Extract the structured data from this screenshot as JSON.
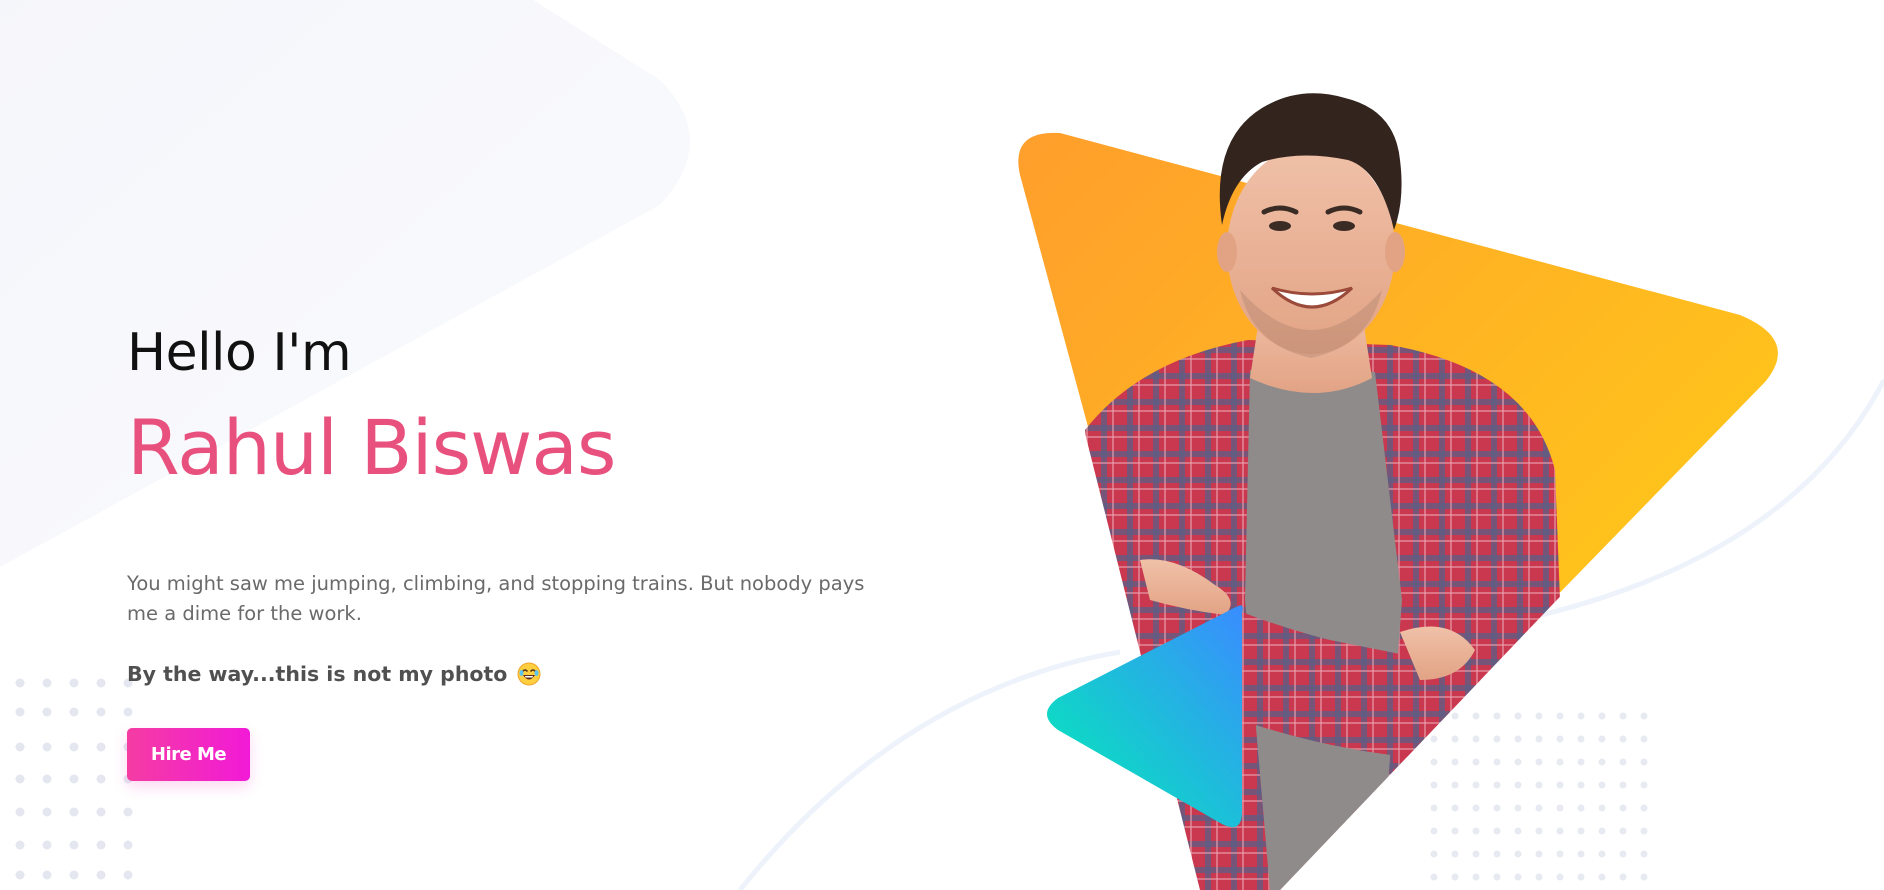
{
  "hero": {
    "greeting": "Hello I'm",
    "name": "Rahul Biswas",
    "description": "You might saw me jumping, climbing, and stopping trains. But nobody pays me a dime for the work.",
    "byline": "By the way...this is not my photo",
    "cta_label": "Hire Me"
  },
  "icons": {
    "byline_emoji": "laughing-face-icon"
  },
  "colors": {
    "name": "#e8517e",
    "cta_start": "#f43ca3",
    "cta_end": "#f21ad7",
    "triangle_start": "#ff9e2c",
    "triangle_end": "#ffd414",
    "play_start": "#3a8cff",
    "play_end": "#00f0b4"
  }
}
